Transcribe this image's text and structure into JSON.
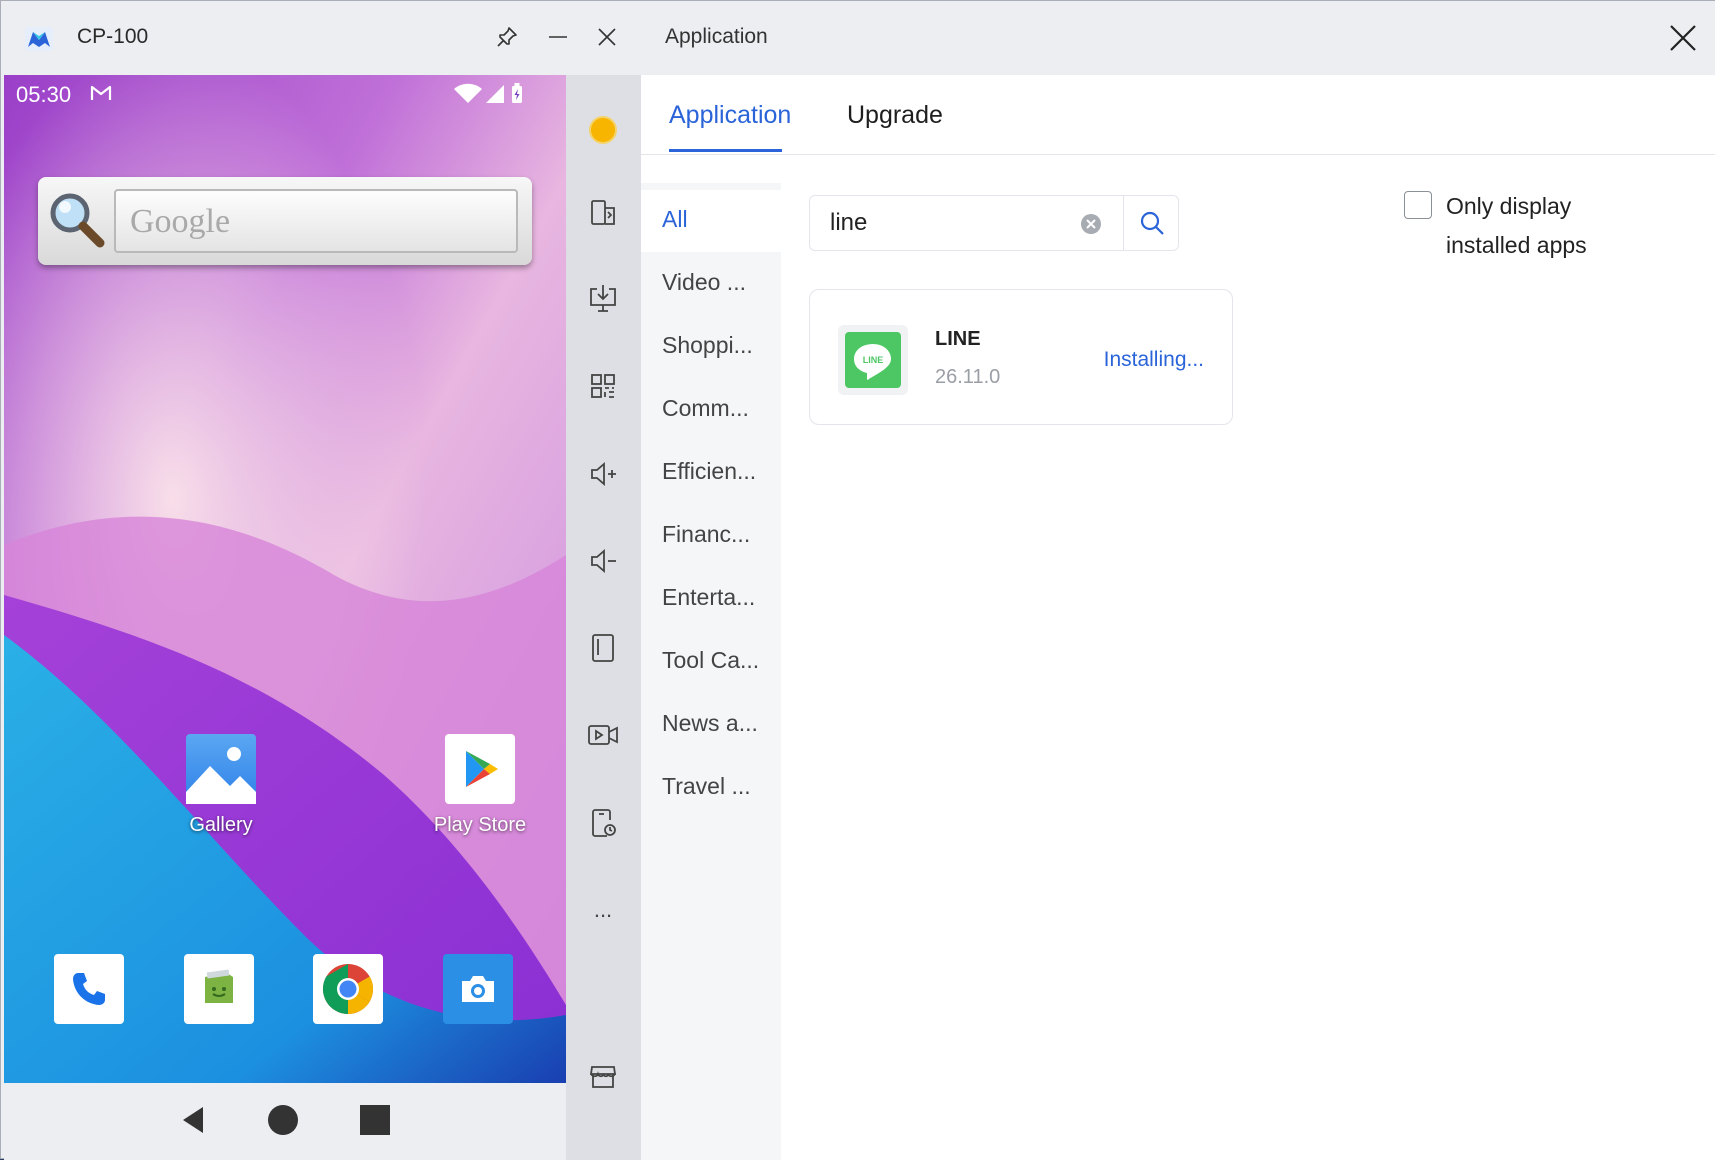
{
  "phone_window": {
    "title": "CP-100",
    "status_time": "05:30",
    "google_placeholder": "Google",
    "home_apps": [
      {
        "label": "Gallery",
        "icon": "gallery-icon"
      },
      {
        "label": "Play Store",
        "icon": "play-store-icon"
      }
    ],
    "dock": [
      "phone-icon",
      "messaging-icon",
      "chrome-icon",
      "camera-icon"
    ],
    "nav": [
      "back-icon",
      "home-icon",
      "recents-icon"
    ]
  },
  "toolbar": {
    "items": [
      "indicator-dot",
      "screen-rotate-icon",
      "install-apk-icon",
      "apps-grid-icon",
      "volume-up-icon",
      "volume-down-icon",
      "rotate-device-icon",
      "screen-record-icon",
      "device-info-icon",
      "more-icon",
      "store-icon"
    ],
    "more_label": "..."
  },
  "app_panel": {
    "title": "Application",
    "tabs": [
      {
        "label": "Application",
        "active": true
      },
      {
        "label": "Upgrade",
        "active": false
      }
    ],
    "categories": [
      "All",
      "Video ...",
      "Shoppi...",
      "Comm...",
      "Efficien...",
      "Financ...",
      "Enterta...",
      "Tool Ca...",
      "News a...",
      "Travel ..."
    ],
    "search": {
      "value": "line"
    },
    "filter": {
      "label": "Only display installed apps",
      "checked": false
    },
    "results": [
      {
        "name": "LINE",
        "version": "26.11.0",
        "status": "Installing...",
        "icon_text": "LINE"
      }
    ]
  },
  "colors": {
    "accent": "#2a64d8",
    "line_green": "#4cc764"
  }
}
